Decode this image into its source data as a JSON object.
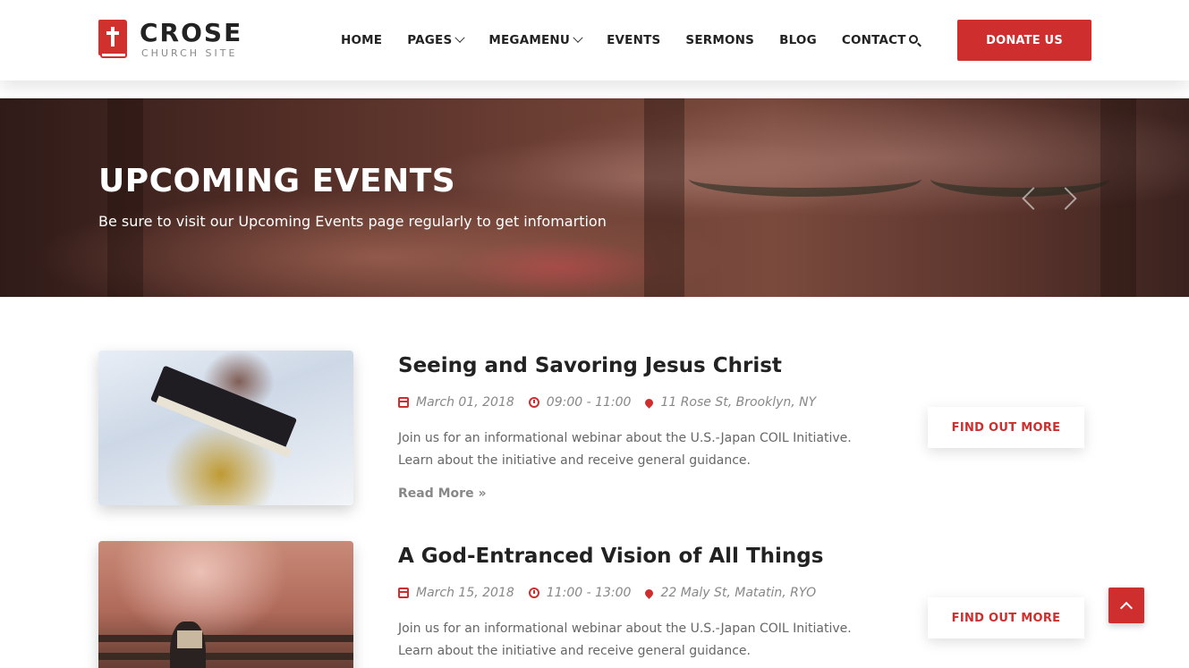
{
  "brand": {
    "name": "CROSE",
    "tagline": "CHURCH SITE",
    "accent_color": "#cf2e2e"
  },
  "nav": {
    "items": [
      {
        "label": "HOME",
        "has_dropdown": false
      },
      {
        "label": "PAGES",
        "has_dropdown": true
      },
      {
        "label": "MEGAMENU",
        "has_dropdown": true
      },
      {
        "label": "EVENTS",
        "has_dropdown": false
      },
      {
        "label": "SERMONS",
        "has_dropdown": false
      },
      {
        "label": "BLOG",
        "has_dropdown": false
      },
      {
        "label": "CONTACT",
        "has_dropdown": false
      }
    ],
    "search_icon": "search-icon",
    "donate_label": "DONATE US"
  },
  "hero": {
    "title": "UPCOMING EVENTS",
    "subtitle": "Be sure to visit our Upcoming Events page regularly to get infomartion",
    "prev_icon": "chevron-left-icon",
    "next_icon": "chevron-right-icon"
  },
  "events": [
    {
      "title": "Seeing and Savoring Jesus Christ",
      "date": "March 01, 2018",
      "time": "09:00 - 11:00",
      "location": "11 Rose St, Brooklyn, NY",
      "description": "Join us for an informational webinar about the U.S.-Japan COIL Initiative. Learn about the initiative and receive general guidance.",
      "read_more": "Read More »",
      "button": "FIND OUT MORE"
    },
    {
      "title": "A God-Entranced Vision of All Things",
      "date": "March 15, 2018",
      "time": "11:00 - 13:00",
      "location": "22 Maly St, Matatin, RYO",
      "description": "Join us for an informational webinar about the U.S.-Japan COIL Initiative. Learn about the initiative and receive general guidance.",
      "button": "FIND OUT MORE"
    }
  ],
  "back_to_top_icon": "chevron-up-icon"
}
